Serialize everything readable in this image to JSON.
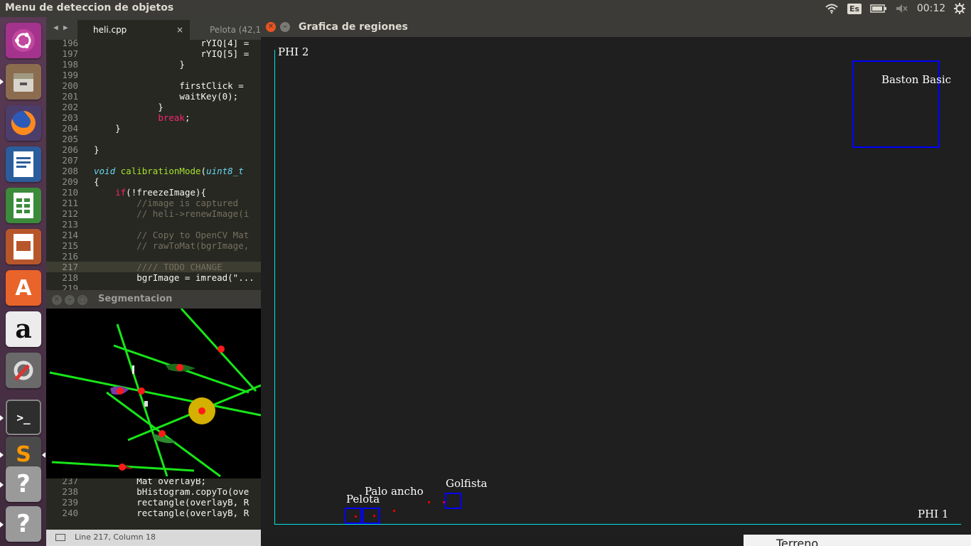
{
  "topbar": {
    "app_title": "Menu de deteccion de objetos",
    "keyboard_layout": "Es",
    "clock": "00:12",
    "icons": [
      "wifi-icon",
      "keyboard-icon",
      "battery-icon",
      "volume-muted-icon",
      "settings-gear-icon"
    ]
  },
  "launcher": {
    "items": [
      {
        "name": "ubuntu-dash",
        "icon": "ubuntu-logo-icon"
      },
      {
        "name": "files",
        "icon": "file-cabinet-icon"
      },
      {
        "name": "firefox",
        "icon": "firefox-icon"
      },
      {
        "name": "libreoffice-writer",
        "icon": "writer-icon"
      },
      {
        "name": "libreoffice-calc",
        "icon": "calc-icon"
      },
      {
        "name": "libreoffice-impress",
        "icon": "impress-icon"
      },
      {
        "name": "software-center",
        "icon": "shopping-bag-icon",
        "glyph": "A"
      },
      {
        "name": "amazon",
        "icon": "amazon-icon",
        "glyph": "a"
      },
      {
        "name": "system-settings",
        "icon": "wrench-gear-icon"
      },
      {
        "name": "terminal",
        "icon": "terminal-icon",
        "glyph": ">_"
      },
      {
        "name": "sublime-text",
        "icon": "sublime-icon",
        "glyph": "S"
      },
      {
        "name": "unknown-app-1",
        "icon": "question-icon",
        "glyph": "?"
      },
      {
        "name": "unknown-app-2",
        "icon": "question-icon",
        "glyph": "?"
      }
    ]
  },
  "editor": {
    "tabs": [
      {
        "label": "heli.cpp",
        "close": "×"
      },
      {
        "label": "Pelota (42,15"
      }
    ],
    "lines_top": [
      {
        "n": "196",
        "code": "                    rYIQ[4] ="
      },
      {
        "n": "197",
        "code": "                    rYIQ[5] ="
      },
      {
        "n": "198",
        "code": "                }"
      },
      {
        "n": "199",
        "code": ""
      },
      {
        "n": "200",
        "code": "                firstClick = "
      },
      {
        "n": "201",
        "code": "                waitKey(0);"
      },
      {
        "n": "202",
        "code": "            }"
      },
      {
        "n": "203",
        "code": "            break;"
      },
      {
        "n": "204",
        "code": "    }"
      },
      {
        "n": "205",
        "code": ""
      },
      {
        "n": "206",
        "code": "}"
      },
      {
        "n": "207",
        "code": ""
      },
      {
        "n": "208",
        "code": "void calibrationMode(uint8_t "
      },
      {
        "n": "209",
        "code": "{"
      },
      {
        "n": "210",
        "code": "    if(!freezeImage){"
      },
      {
        "n": "211",
        "code": "        //image is captured"
      },
      {
        "n": "212",
        "code": "        // heli->renewImage(i"
      },
      {
        "n": "213",
        "code": ""
      },
      {
        "n": "214",
        "code": "        // Copy to OpenCV Mat"
      },
      {
        "n": "215",
        "code": "        // rawToMat(bgrImage,"
      },
      {
        "n": "216",
        "code": ""
      },
      {
        "n": "217",
        "code": "        //// TODO CHANGE"
      },
      {
        "n": "218",
        "code": "        bgrImage = imread(\"..."
      },
      {
        "n": "219",
        "code": ""
      }
    ],
    "lines_bottom": [
      {
        "n": "237",
        "code": "        Mat overlayB;"
      },
      {
        "n": "238",
        "code": "        bHistogram.copyTo(ove"
      },
      {
        "n": "239",
        "code": "        rectangle(overlayB, R"
      },
      {
        "n": "240",
        "code": "        rectangle(overlayB, R"
      }
    ],
    "status": "Line 217, Column 18"
  },
  "segmentation_window": {
    "title": "Segmentacion"
  },
  "grafica_window": {
    "title": "Grafica de regiones",
    "axis_y_label": "PHI 2",
    "axis_x_label": "PHI 1",
    "regions": [
      {
        "label": "Baston Basic"
      },
      {
        "label": "Golfista"
      },
      {
        "label": "Palo ancho"
      },
      {
        "label": "Pelota"
      }
    ],
    "colors": {
      "axis": "#00e5e5",
      "region_box": "#0000ff",
      "points": "#e00000",
      "background": "#1f1f1f"
    }
  },
  "background_text": "Terreno"
}
